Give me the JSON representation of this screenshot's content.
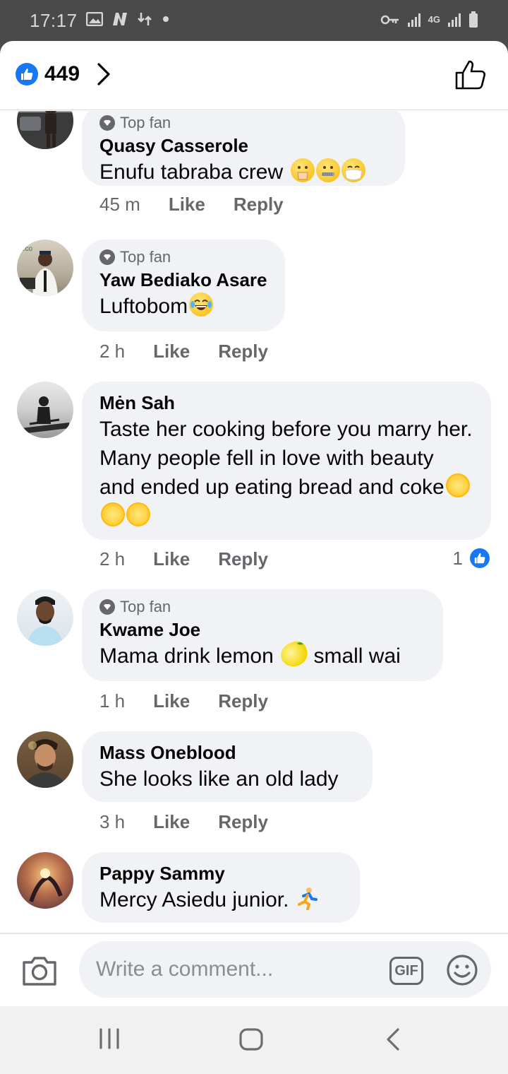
{
  "status_bar": {
    "time": "17:17",
    "left_icons": [
      "image-icon",
      "n-app-icon",
      "data-transfer-icon",
      "dot-icon"
    ],
    "right_icons": [
      "key-icon",
      "signal-icon",
      "4g-icon",
      "signal-icon",
      "battery-icon"
    ],
    "network_label": "4G"
  },
  "header": {
    "reaction_count": "449"
  },
  "comments": [
    {
      "badge": "Top fan",
      "author": "Quasy Casserole",
      "text": "Enufu tabraba crew",
      "emojis": [
        "hand-over-mouth-emoji",
        "zipper-mouth-emoji",
        "mask-face-emoji"
      ],
      "time": "45 m",
      "like_label": "Like",
      "reply_label": "Reply"
    },
    {
      "badge": "Top fan",
      "author": "Yaw Bediako Asare",
      "text": "Luftobom",
      "emojis": [
        "tears-of-joy-emoji"
      ],
      "time": "2 h",
      "like_label": "Like",
      "reply_label": "Reply"
    },
    {
      "badge": "",
      "author": "Mėn Sah",
      "text": "Taste her cooking before you marry her. Many people fell in love with beauty and ended up eating bread and coke",
      "emojis": [
        "sun-face-emoji",
        "sun-face-emoji",
        "sun-face-emoji"
      ],
      "time": "2 h",
      "like_label": "Like",
      "reply_label": "Reply",
      "like_count": "1"
    },
    {
      "badge": "Top fan",
      "author": "Kwame Joe",
      "text_before": "Mama drink lemon",
      "text_after": "small wai",
      "emojis": [
        "lemon-emoji"
      ],
      "time": "1 h",
      "like_label": "Like",
      "reply_label": "Reply"
    },
    {
      "badge": "",
      "author": "Mass Oneblood",
      "text": "She looks like an old lady",
      "emojis": [],
      "time": "3 h",
      "like_label": "Like",
      "reply_label": "Reply"
    },
    {
      "badge": "",
      "author": "Pappy Sammy",
      "text": "Mercy Asiedu junior.",
      "emojis": [
        "running-person-emoji"
      ],
      "time": "",
      "like_label": "",
      "reply_label": ""
    }
  ],
  "composer": {
    "placeholder": "Write a comment...",
    "gif_label": "GIF"
  },
  "colors": {
    "accent": "#1877f2",
    "bubble": "#f0f2f5",
    "secondary_text": "#65676b",
    "status_bar": "#4a4a4a"
  }
}
